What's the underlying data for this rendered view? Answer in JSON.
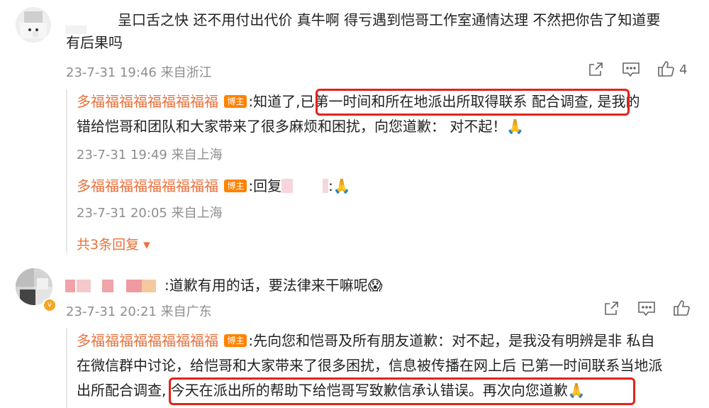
{
  "comments": [
    {
      "text_line1": "呈口舌之快 还不用付出代价 真牛啊 得亏遇到恺哥工作室通情达理 不然把你告了知道要",
      "text_line2": "有后果吗",
      "meta": "23-7-31 19:46 来自浙江",
      "like_count": "4",
      "replies": [
        {
          "author": "多福福福福福福福福福",
          "badge": "博主",
          "prefix": ":知道了,",
          "highlight": "已第一时间和所在地派出所取得联系 配合调查,",
          "rest": " 是我的",
          "line2": "错给恺哥和团队和大家带来了很多麻烦和困扰，向您道歉： 对不起！🙏",
          "meta": "23-7-31 19:49 来自上海"
        },
        {
          "author": "多福福福福福福福福福",
          "badge": "博主",
          "text": ":回复",
          "trail": ":🙏",
          "meta": "23-7-31 20:05 来自上海"
        }
      ],
      "more_replies": "共3条回复 ▾"
    },
    {
      "text": ":道歉有用的话，要法律来干嘛呢😱",
      "meta": "23-7-31 20:21 来自广东",
      "reply": {
        "author": "多福福福福福福福福福",
        "badge": "博主",
        "line1": ":先向您和恺哥及所有朋友道歉：对不起，是我没有明辨是非 私自",
        "line2": "在微信群中讨论，给恺哥和大家带来了很多困扰，信息被传播在网上后 已第一时间联系当地派",
        "line3_prefix": "出所配合调查,",
        "line3_highlight": " 今天在派出所的帮助下给恺哥写致歉信承认错误。再次向您道歉🙏"
      }
    }
  ],
  "icons": [
    "share-icon",
    "comment-icon",
    "like-icon"
  ],
  "colors": {
    "name": "#e8713c",
    "badge": "#ff8200",
    "highlight_box": "#e2231a",
    "meta": "#8e8e8e"
  }
}
